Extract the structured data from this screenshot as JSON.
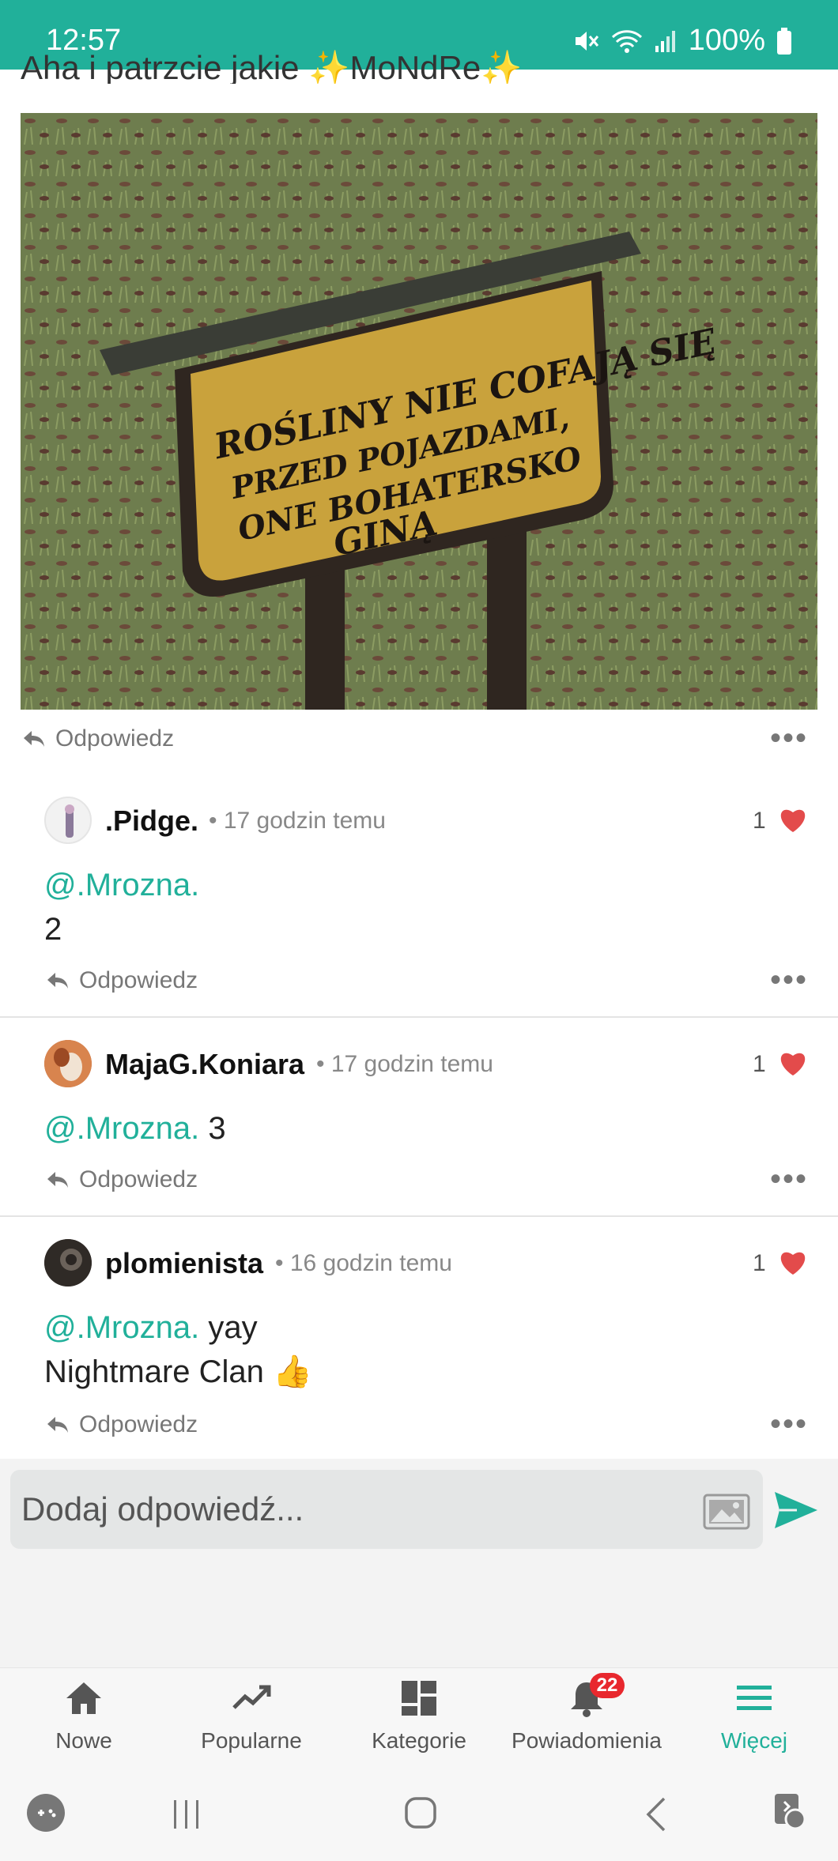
{
  "status_bar": {
    "time": "12:57",
    "battery": "100%"
  },
  "post": {
    "title": "Aha i patrzcie jakie ✨MoNdRe✨",
    "image_sign_text": [
      "ROŚLINY NIE COFAJĄ SIĘ",
      "PRZED POJAZDAMI,",
      "ONE BOHATERSKO",
      "GINĄ"
    ],
    "reply_label": "Odpowiedz"
  },
  "comments": [
    {
      "username": ".Pidge.",
      "time": "17 godzin temu",
      "likes": "1",
      "mention": "@.Mrozna.",
      "text_after_mention": "",
      "extra_line": "2",
      "reply_label": "Odpowiedz"
    },
    {
      "username": "MajaG.Koniara",
      "time": "17 godzin temu",
      "likes": "1",
      "mention": "@.Mrozna.",
      "text_after_mention": " 3",
      "extra_line": "",
      "reply_label": "Odpowiedz"
    },
    {
      "username": "plomienista",
      "time": "16 godzin temu",
      "likes": "1",
      "mention": "@.Mrozna.",
      "text_after_mention": " yay",
      "extra_line": "Nightmare Clan 👍",
      "reply_label": "Odpowiedz"
    }
  ],
  "reply_box": {
    "placeholder": "Dodaj odpowiedź..."
  },
  "bottom_nav": {
    "items": [
      {
        "label": "Nowe",
        "icon": "home-icon"
      },
      {
        "label": "Popularne",
        "icon": "trending-icon"
      },
      {
        "label": "Kategorie",
        "icon": "grid-icon"
      },
      {
        "label": "Powiadomienia",
        "icon": "bell-icon",
        "badge": "22"
      },
      {
        "label": "Więcej",
        "icon": "menu-icon",
        "active": true
      }
    ]
  },
  "colors": {
    "accent": "#21b09a",
    "heart": "#e34b4b",
    "badge": "#e8282e"
  }
}
